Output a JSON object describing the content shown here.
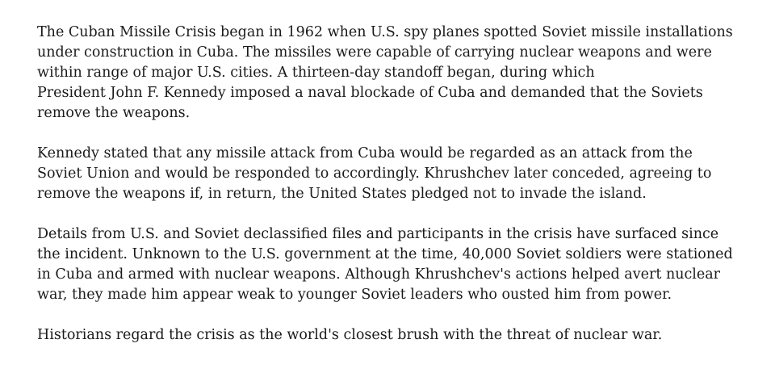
{
  "document": {
    "paragraphs": [
      {
        "lines": [
          "The Cuban Missile Crisis began in 1962 when U.S. spy planes spotted Soviet missile installations",
          "under construction in Cuba. The missiles were capable of carrying nuclear weapons and were",
          "within range of major U.S. cities. A thirteen-day standoff began, during which",
          "President John F. Kennedy imposed a naval blockade of Cuba and demanded that the Soviets",
          "remove the weapons."
        ]
      },
      {
        "lines": [
          "Kennedy stated that any missile attack from Cuba would be regarded as an attack from the",
          "Soviet Union and would be responded to accordingly. Khrushchev later conceded, agreeing to",
          "remove the weapons if, in return, the United States pledged not to invade the island."
        ]
      },
      {
        "lines": [
          "Details from U.S. and Soviet declassified files and participants in the crisis have surfaced since",
          "the incident. Unknown to the U.S. government at the time, 40,000 Soviet soldiers were stationed",
          "in Cuba and armed with nuclear weapons. Although Khrushchev's actions helped avert nuclear",
          "war, they made him appear weak to younger Soviet leaders who ousted him from power."
        ]
      },
      {
        "lines": [
          "Historians regard the crisis as the world's closest brush with the threat of nuclear war."
        ]
      }
    ]
  }
}
